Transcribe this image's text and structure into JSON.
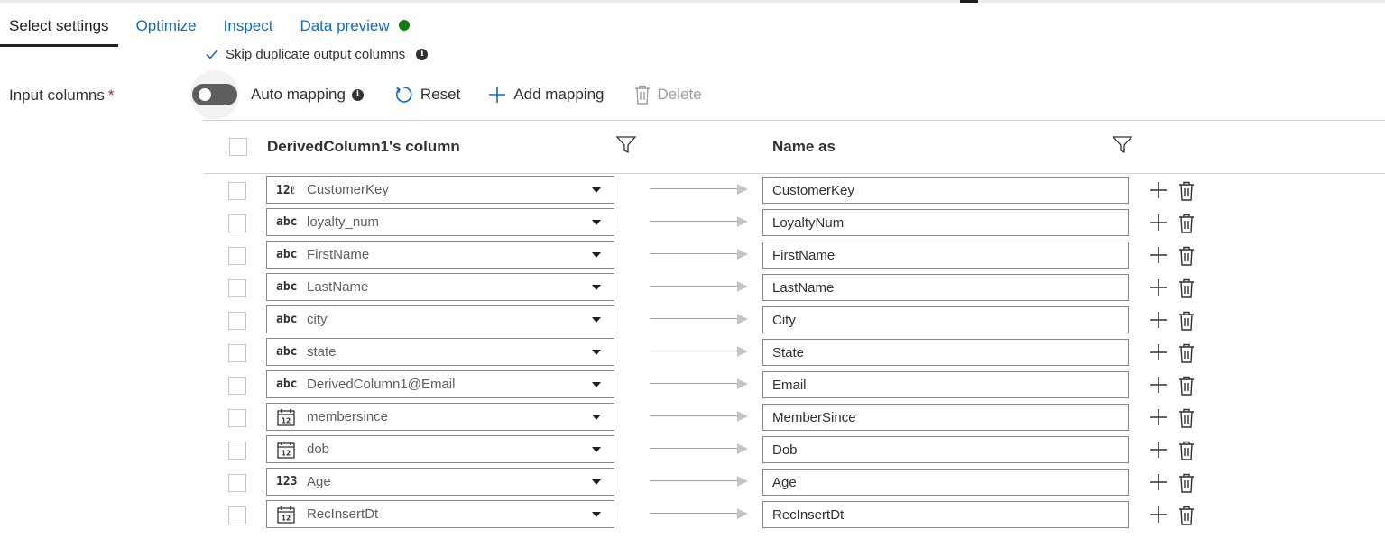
{
  "tabs": [
    {
      "label": "Select settings"
    },
    {
      "label": "Optimize"
    },
    {
      "label": "Inspect"
    },
    {
      "label": "Data preview"
    }
  ],
  "status_color": "#107c10",
  "skip_duplicate": {
    "label": "Skip duplicate output columns",
    "checked": true
  },
  "input_columns": {
    "label": "Input columns",
    "required_mark": "*"
  },
  "toolbar": {
    "auto_mapping_label": "Auto mapping",
    "auto_mapping_on": false,
    "reset_label": "Reset",
    "add_mapping_label": "Add mapping",
    "delete_label": "Delete"
  },
  "table": {
    "source_header": "DerivedColumn1's column",
    "dest_header": "Name as",
    "rows": [
      {
        "type": "12ℓ",
        "type_icon": "integer-long-icon",
        "source": "CustomerKey",
        "dest": "CustomerKey"
      },
      {
        "type": "abc",
        "type_icon": "string-icon",
        "source": "loyalty_num",
        "dest": "LoyaltyNum"
      },
      {
        "type": "abc",
        "type_icon": "string-icon",
        "source": "FirstName",
        "dest": "FirstName"
      },
      {
        "type": "abc",
        "type_icon": "string-icon",
        "source": "LastName",
        "dest": "LastName"
      },
      {
        "type": "abc",
        "type_icon": "string-icon",
        "source": "city",
        "dest": "City"
      },
      {
        "type": "abc",
        "type_icon": "string-icon",
        "source": "state",
        "dest": "State"
      },
      {
        "type": "abc",
        "type_icon": "string-icon",
        "source": "DerivedColumn1@Email",
        "dest": "Email"
      },
      {
        "type": "12",
        "type_icon": "calendar-icon",
        "source": "membersince",
        "dest": "MemberSince"
      },
      {
        "type": "12",
        "type_icon": "calendar-icon",
        "source": "dob",
        "dest": "Dob"
      },
      {
        "type": "123",
        "type_icon": "integer-icon",
        "source": "Age",
        "dest": "Age"
      },
      {
        "type": "12",
        "type_icon": "calendar-icon",
        "source": "RecInsertDt",
        "dest": "RecInsertDt"
      }
    ]
  }
}
